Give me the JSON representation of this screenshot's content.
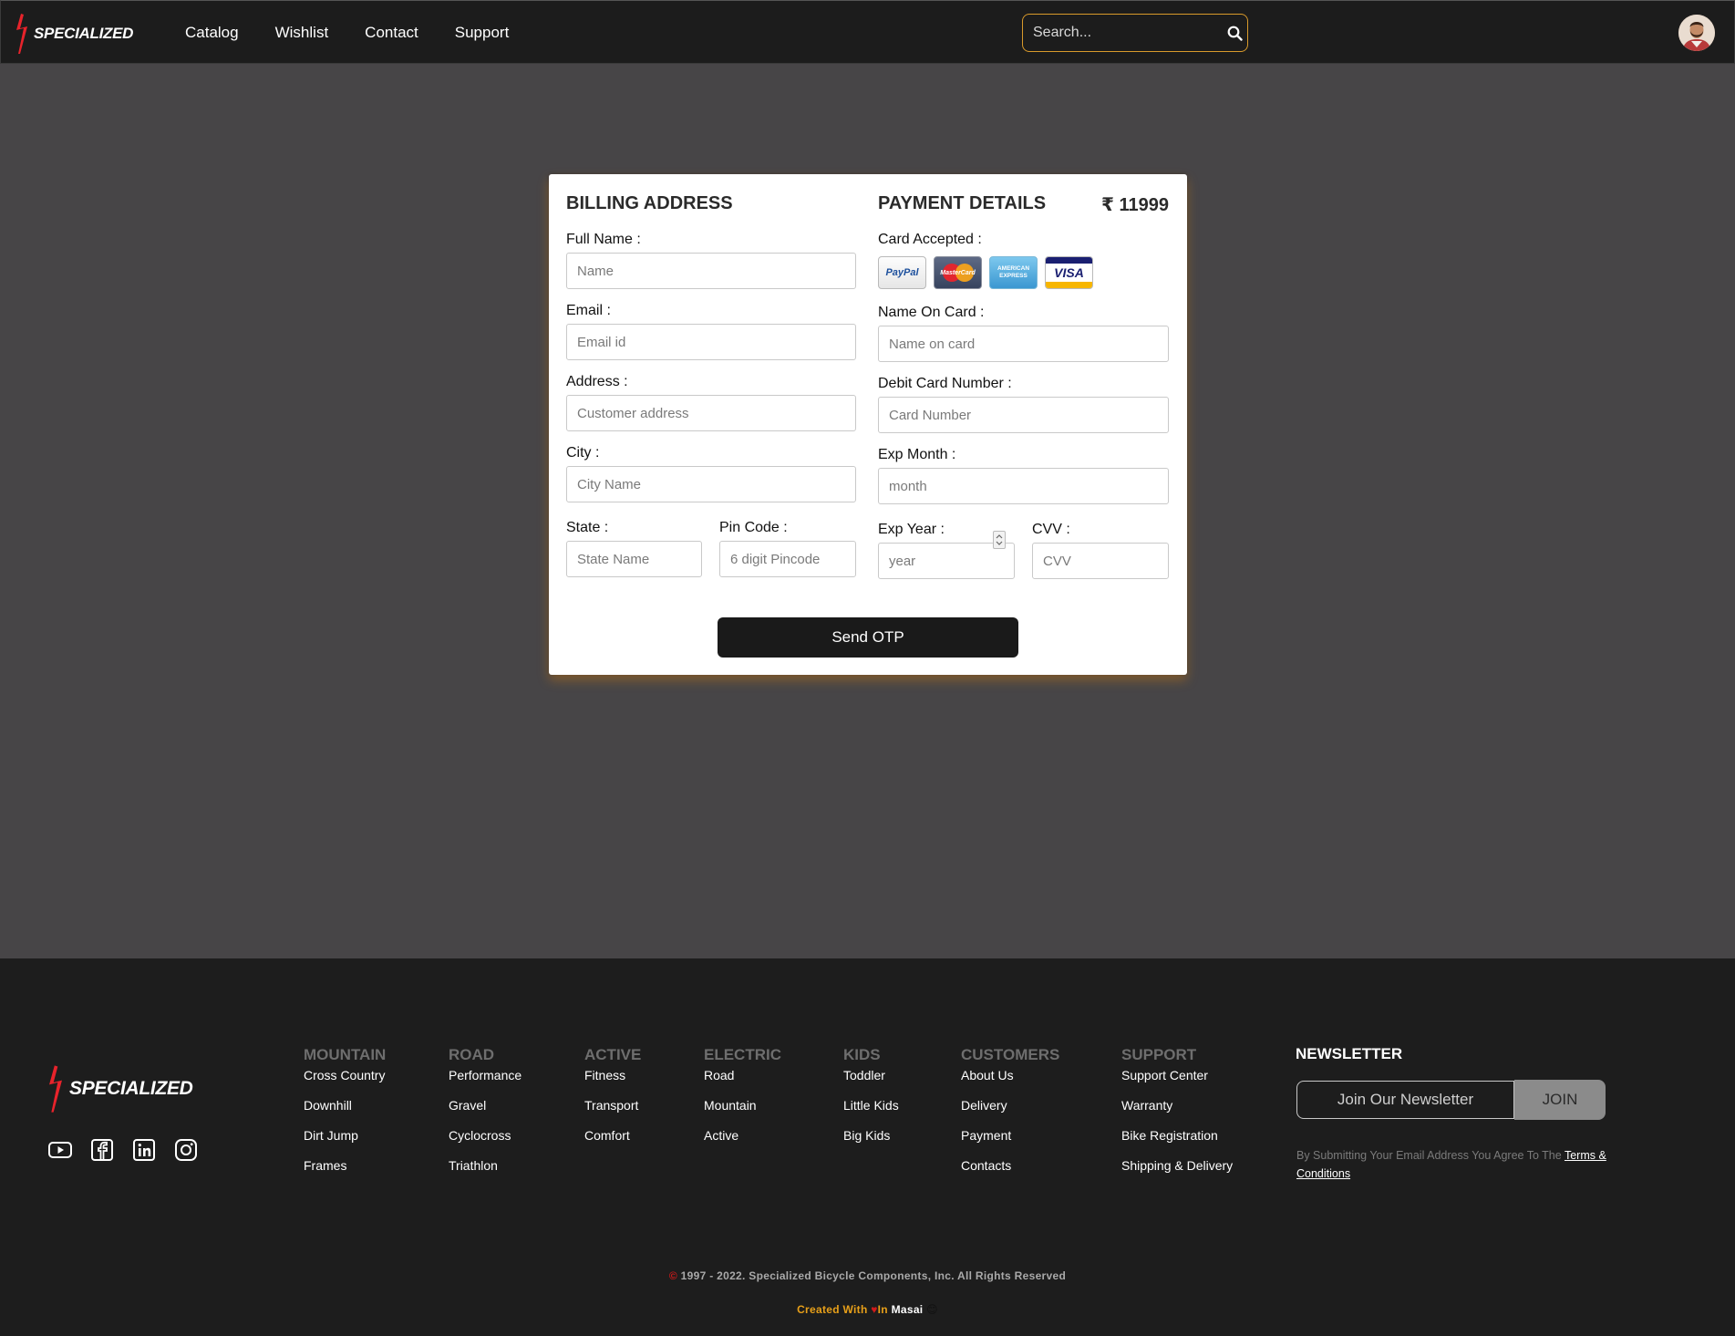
{
  "brand": {
    "name": "SPECIALIZED",
    "accent": "#e8232b"
  },
  "nav": {
    "links": [
      "Catalog",
      "Wishlist",
      "Contact",
      "Support"
    ],
    "search_placeholder": "Search...",
    "search_icon": "search-icon",
    "avatar": "user-avatar"
  },
  "billing": {
    "title": "BILLING ADDRESS",
    "full_name": {
      "label": "Full Name :",
      "placeholder": "Name"
    },
    "email": {
      "label": "Email :",
      "placeholder": "Email id"
    },
    "address": {
      "label": "Address :",
      "placeholder": "Customer address"
    },
    "city": {
      "label": "City :",
      "placeholder": "City Name"
    },
    "state": {
      "label": "State :",
      "placeholder": "State Name"
    },
    "pincode": {
      "label": "Pin Code :",
      "placeholder": "6 digit Pincode"
    }
  },
  "payment": {
    "title": "PAYMENT DETAILS",
    "price": "₹ 11999",
    "cards_label": "Card Accepted :",
    "cards": {
      "paypal": "PayPal",
      "mastercard": "MasterCard",
      "amex_line1": "AMERICAN",
      "amex_line2": "EXPRESS",
      "visa": "VISA"
    },
    "name_on_card": {
      "label": "Name On Card :",
      "placeholder": "Name on card"
    },
    "card_number": {
      "label": "Debit Card Number :",
      "placeholder": "Card Number"
    },
    "exp_month": {
      "label": "Exp Month :",
      "placeholder": "month"
    },
    "exp_year": {
      "label": "Exp Year :",
      "placeholder": "year"
    },
    "cvv": {
      "label": "CVV :",
      "placeholder": "CVV"
    }
  },
  "send_otp": "Send OTP",
  "footer": {
    "columns": [
      {
        "head": "MOUNTAIN",
        "items": [
          "Cross Country",
          "Downhill",
          "Dirt Jump",
          "Frames"
        ]
      },
      {
        "head": "ROAD",
        "items": [
          "Performance",
          "Gravel",
          "Cyclocross",
          "Triathlon"
        ]
      },
      {
        "head": "ACTIVE",
        "items": [
          "Fitness",
          "Transport",
          "Comfort"
        ]
      },
      {
        "head": "ELECTRIC",
        "items": [
          "Road",
          "Mountain",
          "Active"
        ]
      },
      {
        "head": "KIDS",
        "items": [
          "Toddler",
          "Little Kids",
          "Big Kids"
        ]
      },
      {
        "head": "CUSTOMERS",
        "items": [
          "About Us",
          "Delivery",
          "Payment",
          "Contacts"
        ]
      },
      {
        "head": "SUPPORT",
        "items": [
          "Support Center",
          "Warranty",
          "Bike Registration",
          "Shipping & Delivery"
        ]
      }
    ],
    "socials": [
      "youtube-icon",
      "facebook-icon",
      "linkedin-icon",
      "instagram-icon"
    ],
    "newsletter": {
      "title": "NEWSLETTER",
      "placeholder": "Join Our Newsletter",
      "button": "JOIN",
      "terms_text": "By Submitting Your Email Address You Agree To The",
      "terms_link": "Terms & Conditions"
    },
    "copyright_symbol": "©",
    "copyright": " 1997 - 2022. Specialized Bicycle Components, Inc. All Rights Reserved",
    "created_with": "Created With",
    "heart": "♥",
    "in_text": "In",
    "masai": "Masai",
    "smiley": "😊"
  }
}
